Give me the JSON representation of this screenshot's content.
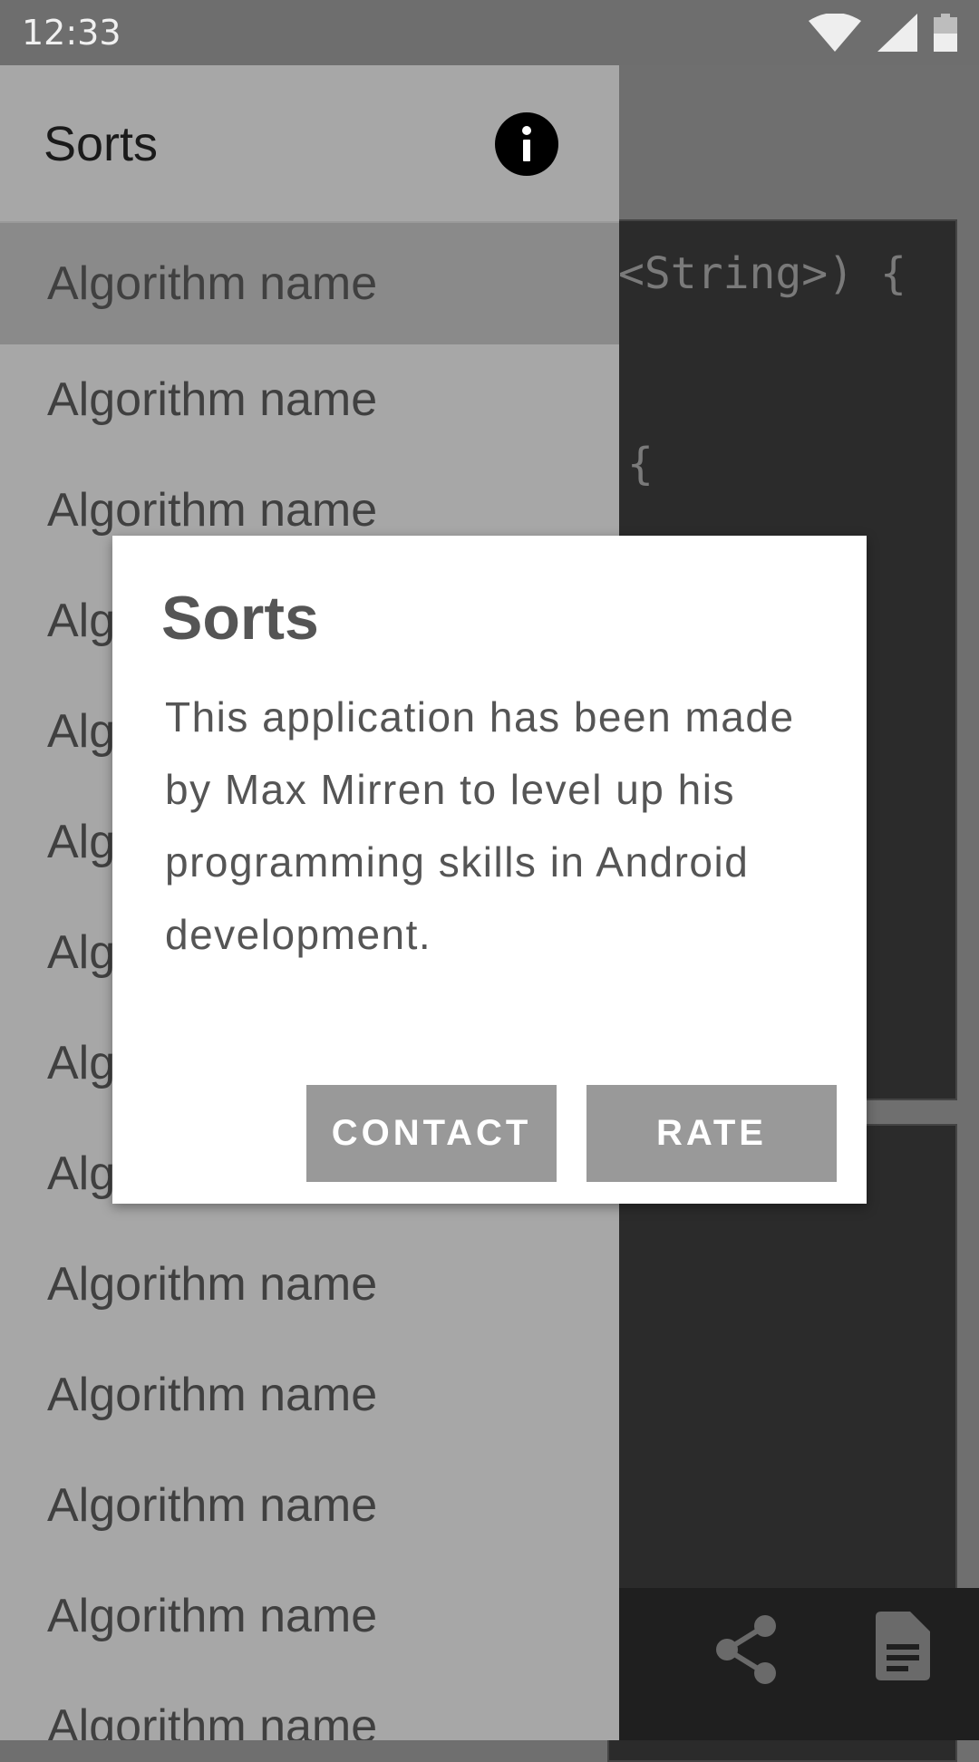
{
  "status_bar": {
    "time": "12:33"
  },
  "code_view": {
    "line1": "<String>) {",
    "line2": "{"
  },
  "drawer": {
    "title": "Sorts",
    "items": [
      "Algorithm name",
      "Algorithm name",
      "Algorithm name",
      "Algorithm name",
      "Algorithm name",
      "Algorithm name",
      "Algorithm name",
      "Algorithm name",
      "Algorithm name",
      "Algorithm name",
      "Algorithm name",
      "Algorithm name",
      "Algorithm name",
      "Algorithm name"
    ]
  },
  "dialog": {
    "title": "Sorts",
    "message": "This application has been made by Max Mirren to level up his programming skills in Android development.",
    "contact_label": "CONTACT",
    "rate_label": "RATE"
  },
  "icons": {
    "info": "info-icon",
    "share": "share-icon",
    "document": "document-icon",
    "wifi": "wifi-icon",
    "signal": "signal-icon",
    "battery": "battery-icon"
  },
  "colors": {
    "drawer_bg": "#a7a7a7",
    "selected_item": "#8a8a8a",
    "dialog_button": "#999999",
    "code_bg": "#2b2b2b"
  }
}
